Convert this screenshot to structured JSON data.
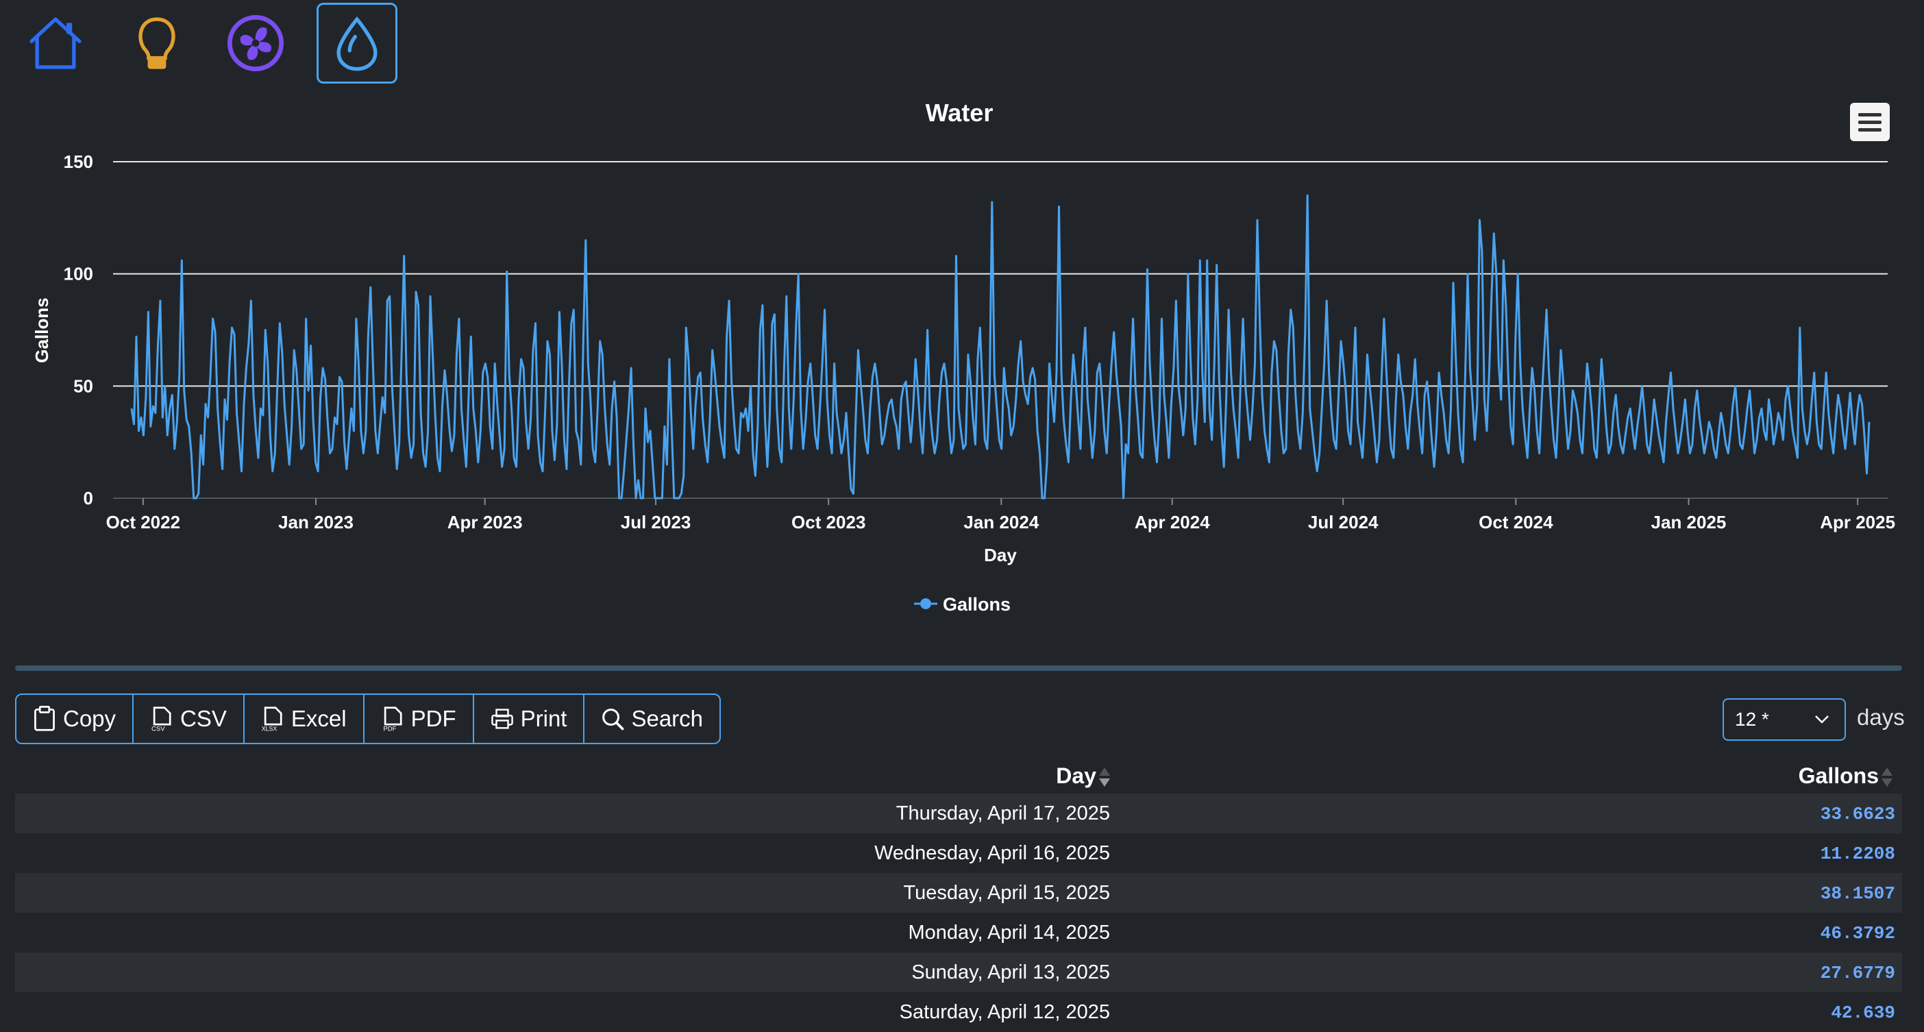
{
  "nav": {
    "items": [
      {
        "name": "home",
        "icon": "home-icon",
        "color": "#2f6bf0",
        "active": false
      },
      {
        "name": "light",
        "icon": "lightbulb-icon",
        "color": "#e0a030",
        "active": false
      },
      {
        "name": "fan",
        "icon": "fan-icon",
        "color": "#7b4df0",
        "active": false
      },
      {
        "name": "water",
        "icon": "water-drop-icon",
        "color": "#4aa3f0",
        "active": true
      }
    ]
  },
  "chart_data": {
    "type": "line",
    "title": "Water",
    "xlabel": "Day",
    "ylabel": "Gallons",
    "ylim": [
      0,
      150
    ],
    "yticks": [
      0,
      50,
      100,
      150
    ],
    "xticks": [
      "Oct 2022",
      "Jan 2023",
      "Apr 2023",
      "Jul 2023",
      "Oct 2023",
      "Jan 2024",
      "Apr 2024",
      "Jul 2024",
      "Oct 2024",
      "Jan 2025",
      "Apr 2025"
    ],
    "x_start": "2022-09-15",
    "x_end": "2025-04-17",
    "grid": true,
    "legend_position": "bottom-center",
    "series": [
      {
        "name": "Gallons",
        "color": "#4aa3f0",
        "values": [
          40,
          33,
          72,
          30,
          36,
          28,
          45,
          83,
          32,
          41,
          38,
          68,
          88,
          36,
          50,
          28,
          40,
          46,
          22,
          34,
          55,
          106,
          48,
          35,
          32,
          20,
          0,
          0,
          2,
          28,
          15,
          42,
          36,
          55,
          80,
          74,
          40,
          25,
          13,
          44,
          35,
          60,
          76,
          73,
          38,
          25,
          12,
          42,
          58,
          69,
          88,
          46,
          30,
          18,
          40,
          37,
          75,
          60,
          28,
          12,
          20,
          50,
          78,
          65,
          41,
          28,
          15,
          32,
          66,
          57,
          40,
          22,
          24,
          80,
          48,
          68,
          35,
          16,
          12,
          45,
          58,
          53,
          35,
          20,
          22,
          36,
          33,
          54,
          52,
          25,
          13,
          27,
          40,
          30,
          80,
          60,
          30,
          20,
          30,
          72,
          94,
          60,
          30,
          20,
          33,
          45,
          38,
          88,
          90,
          50,
          30,
          13,
          25,
          66,
          108,
          55,
          28,
          18,
          24,
          92,
          86,
          38,
          20,
          14,
          30,
          90,
          64,
          38,
          18,
          12,
          41,
          57,
          46,
          31,
          21,
          28,
          64,
          80,
          40,
          26,
          14,
          45,
          72,
          40,
          30,
          16,
          30,
          56,
          60,
          54,
          32,
          22,
          60,
          42,
          28,
          14,
          22,
          101,
          55,
          40,
          18,
          14,
          45,
          62,
          58,
          34,
          22,
          35,
          66,
          78,
          28,
          16,
          12,
          38,
          70,
          64,
          30,
          17,
          33,
          83,
          60,
          26,
          13,
          50,
          78,
          84,
          30,
          26,
          15,
          70,
          115,
          60,
          44,
          22,
          16,
          40,
          70,
          64,
          40,
          24,
          15,
          40,
          52,
          36,
          0,
          0,
          12,
          26,
          40,
          58,
          24,
          0,
          8,
          0,
          0,
          40,
          25,
          30,
          15,
          0,
          0,
          0,
          0,
          32,
          15,
          62,
          30,
          0,
          0,
          0,
          2,
          10,
          76,
          62,
          38,
          22,
          42,
          54,
          56,
          35,
          24,
          16,
          36,
          66,
          56,
          44,
          32,
          24,
          18,
          72,
          88,
          52,
          35,
          22,
          20,
          38,
          36,
          40,
          30,
          50,
          20,
          10,
          32,
          75,
          86,
          36,
          14,
          37,
          78,
          82,
          40,
          22,
          16,
          57,
          90,
          40,
          22,
          44,
          76,
          100,
          40,
          22,
          34,
          52,
          60,
          45,
          28,
          22,
          40,
          60,
          84,
          44,
          28,
          20,
          60,
          38,
          30,
          20,
          26,
          38,
          20,
          4,
          2,
          36,
          66,
          52,
          40,
          26,
          20,
          40,
          54,
          60,
          52,
          38,
          24,
          28,
          36,
          42,
          44,
          36,
          32,
          22,
          44,
          50,
          52,
          38,
          25,
          40,
          62,
          48,
          32,
          20,
          44,
          75,
          40,
          28,
          20,
          26,
          44,
          56,
          60,
          52,
          32,
          20,
          26,
          108,
          40,
          30,
          22,
          24,
          64,
          52,
          36,
          24,
          62,
          76,
          50,
          26,
          22,
          48,
          132,
          55,
          40,
          26,
          22,
          58,
          46,
          40,
          28,
          32,
          44,
          60,
          70,
          52,
          46,
          42,
          54,
          58,
          53,
          30,
          20,
          0,
          0,
          16,
          60,
          46,
          34,
          56,
          130,
          56,
          35,
          24,
          16,
          44,
          64,
          52,
          36,
          22,
          60,
          76,
          44,
          32,
          18,
          30,
          56,
          60,
          46,
          30,
          20,
          42,
          60,
          74,
          56,
          44,
          32,
          0,
          24,
          20,
          52,
          80,
          50,
          36,
          20,
          18,
          52,
          102,
          60,
          40,
          26,
          16,
          36,
          80,
          46,
          34,
          18,
          42,
          58,
          88,
          50,
          40,
          28,
          40,
          100,
          64,
          36,
          24,
          44,
          106,
          56,
          34,
          106,
          40,
          26,
          60,
          104,
          54,
          30,
          14,
          44,
          84,
          56,
          40,
          30,
          18,
          52,
          80,
          50,
          38,
          26,
          40,
          60,
          124,
          80,
          46,
          30,
          22,
          16,
          56,
          70,
          66,
          46,
          30,
          20,
          22,
          64,
          84,
          76,
          46,
          30,
          22,
          38,
          74,
          135,
          40,
          30,
          20,
          12,
          20,
          40,
          60,
          88,
          56,
          38,
          26,
          22,
          46,
          70,
          60,
          48,
          30,
          24,
          50,
          76,
          34,
          26,
          18,
          38,
          64,
          50,
          40,
          28,
          16,
          26,
          54,
          80,
          56,
          36,
          22,
          18,
          44,
          64,
          52,
          46,
          32,
          22,
          38,
          46,
          62,
          42,
          30,
          20,
          46,
          52,
          40,
          26,
          14,
          30,
          56,
          46,
          38,
          26,
          20,
          40,
          96,
          64,
          38,
          22,
          16,
          56,
          100,
          58,
          44,
          26,
          42,
          124,
          110,
          44,
          30,
          56,
          90,
          118,
          100,
          60,
          44,
          106,
          86,
          54,
          32,
          24,
          70,
          100,
          60,
          40,
          28,
          18,
          40,
          58,
          48,
          30,
          20,
          44,
          64,
          84,
          56,
          40,
          26,
          18,
          40,
          66,
          52,
          36,
          22,
          30,
          48,
          44,
          38,
          26,
          20,
          42,
          60,
          50,
          38,
          22,
          18,
          40,
          62,
          48,
          32,
          20,
          24,
          38,
          46,
          32,
          24,
          20,
          28,
          36,
          40,
          30,
          22,
          32,
          40,
          50,
          38,
          24,
          20,
          30,
          44,
          36,
          28,
          22,
          16,
          34,
          46,
          56,
          40,
          30,
          20,
          26,
          34,
          44,
          30,
          20,
          24,
          40,
          48,
          36,
          28,
          20,
          26,
          34,
          30,
          22,
          18,
          28,
          38,
          32,
          24,
          20,
          30,
          42,
          50,
          36,
          24,
          22,
          30,
          40,
          48,
          34,
          20,
          26,
          36,
          40,
          30,
          26,
          44,
          36,
          24,
          30,
          38,
          34,
          26,
          44,
          50,
          40,
          30,
          24,
          18,
          76,
          40,
          30,
          24,
          30,
          44,
          56,
          34,
          24,
          22,
          40,
          56,
          38,
          28,
          20,
          34,
          46,
          40,
          30,
          22,
          34,
          47,
          34,
          24,
          38,
          46,
          42,
          28,
          11,
          34
        ]
      }
    ]
  },
  "chart_ui": {
    "menu_icon": "hamburger-menu-icon"
  },
  "toolbar": {
    "buttons": [
      {
        "label": "Copy",
        "icon": "clipboard-icon"
      },
      {
        "label": "CSV",
        "icon": "csv-file-icon"
      },
      {
        "label": "Excel",
        "icon": "xlsx-file-icon"
      },
      {
        "label": "PDF",
        "icon": "pdf-file-icon"
      },
      {
        "label": "Print",
        "icon": "printer-icon"
      },
      {
        "label": "Search",
        "icon": "search-icon"
      }
    ]
  },
  "page_length": {
    "value": "12 *",
    "label": "days"
  },
  "table": {
    "columns": [
      "Day",
      "Gallons"
    ],
    "rows": [
      [
        "Thursday, April 17, 2025",
        "33.6623"
      ],
      [
        "Wednesday, April 16, 2025",
        "11.2208"
      ],
      [
        "Tuesday, April 15, 2025",
        "38.1507"
      ],
      [
        "Monday, April 14, 2025",
        "46.3792"
      ],
      [
        "Sunday, April 13, 2025",
        "27.6779"
      ],
      [
        "Saturday, April 12, 2025",
        "42.639"
      ]
    ]
  }
}
